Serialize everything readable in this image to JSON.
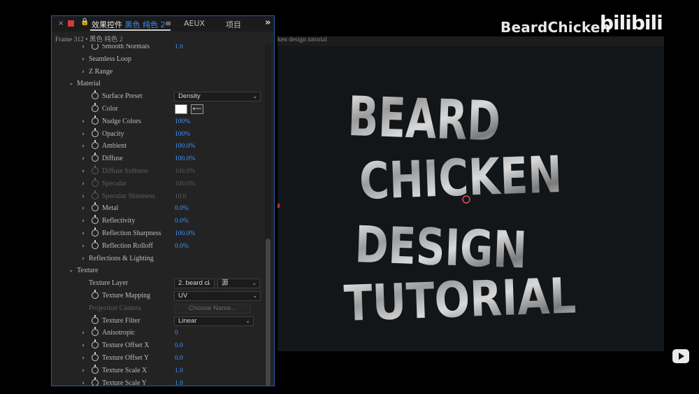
{
  "tabs": {
    "close": "×",
    "lock": "🔒",
    "title_prefix": "效果控件",
    "title_layer": "黑色 纯色 2",
    "menu": "≡",
    "aeux": "AEUX",
    "project": "项目",
    "more": "»"
  },
  "frame_label": "Frame 312 • 黑色 纯色 2",
  "rows": [
    {
      "label": "Smooth Normals",
      "indent": 2,
      "chevron": "right",
      "stopwatch": true,
      "value": "1.0"
    },
    {
      "label": "Seamless Loop",
      "indent": 1,
      "chevron": "right"
    },
    {
      "label": "Z Range",
      "indent": 1,
      "chevron": "right"
    },
    {
      "label": "Material",
      "indent": 0,
      "chevron": "down"
    },
    {
      "label": "Surface Preset",
      "indent": 2,
      "stopwatch": true,
      "select": "Density"
    },
    {
      "label": "Color",
      "indent": 2,
      "stopwatch": true,
      "color": "#ffffff"
    },
    {
      "label": "Nudge Colors",
      "indent": 2,
      "chevron": "right",
      "stopwatch": true,
      "value": "100%"
    },
    {
      "label": "Opacity",
      "indent": 2,
      "chevron": "right",
      "stopwatch": true,
      "value": "100%"
    },
    {
      "label": "Ambient",
      "indent": 2,
      "chevron": "right",
      "stopwatch": true,
      "value": "100.0%"
    },
    {
      "label": "Diffuse",
      "indent": 2,
      "chevron": "right",
      "stopwatch": true,
      "value": "100.0%"
    },
    {
      "label": "Diffuse Softness",
      "indent": 2,
      "chevron": "right",
      "stopwatch": true,
      "value": "100.0%",
      "dim": true
    },
    {
      "label": "Specular",
      "indent": 2,
      "chevron": "right",
      "stopwatch": true,
      "value": "100.0%",
      "dim": true
    },
    {
      "label": "Specular Shininess",
      "indent": 2,
      "chevron": "right",
      "stopwatch": true,
      "value": "10.0",
      "dim": true
    },
    {
      "label": "Metal",
      "indent": 2,
      "chevron": "right",
      "stopwatch": true,
      "value": "0.0%"
    },
    {
      "label": "Reflectivity",
      "indent": 2,
      "chevron": "right",
      "stopwatch": true,
      "value": "0.0%"
    },
    {
      "label": "Reflection Sharpness",
      "indent": 2,
      "chevron": "right",
      "stopwatch": true,
      "value": "100.0%"
    },
    {
      "label": "Reflection Rolloff",
      "indent": 2,
      "chevron": "right",
      "stopwatch": true,
      "value": "0.0%"
    },
    {
      "label": "Reflections & Lighting",
      "indent": 1,
      "chevron": "right"
    },
    {
      "label": "Texture",
      "indent": 0,
      "chevron": "down"
    },
    {
      "label": "Texture Layer",
      "indent": 1.6,
      "select": "2. beard cl",
      "select2": "源"
    },
    {
      "label": "Texture Mapping",
      "indent": 2,
      "stopwatch": true,
      "select": "UV"
    },
    {
      "label": "Projection Camera",
      "indent": 1.6,
      "dim": true,
      "button": "Choose Name..."
    },
    {
      "label": "Texture Filter",
      "indent": 2,
      "stopwatch": true,
      "select": "Linear"
    },
    {
      "label": "Anisotropic",
      "indent": 2,
      "chevron": "right",
      "stopwatch": true,
      "value": "0"
    },
    {
      "label": "Texture Offset X",
      "indent": 2,
      "chevron": "right",
      "stopwatch": true,
      "value": "0.0"
    },
    {
      "label": "Texture Offset Y",
      "indent": 2,
      "chevron": "right",
      "stopwatch": true,
      "value": "0.0"
    },
    {
      "label": "Texture Scale X",
      "indent": 2,
      "chevron": "right",
      "stopwatch": true,
      "value": "1.0"
    },
    {
      "label": "Texture Scale Y",
      "indent": 2,
      "chevron": "right",
      "stopwatch": true,
      "value": "1.0"
    }
  ],
  "viewer": {
    "title": "ken design tutorial",
    "art_lines": [
      "BEARD",
      "CHICKEN",
      "DESIGN",
      "TUTORIAL"
    ]
  },
  "watermark": {
    "text": "BeardChicken",
    "logo": "bilibili"
  },
  "icons": [
    "close-icon",
    "solid-color-icon",
    "lock-icon",
    "menu-icon",
    "overflow-icon",
    "stopwatch-icon",
    "chevron-right-icon",
    "chevron-down-icon",
    "eyedropper-icon",
    "play-tv-icon"
  ]
}
